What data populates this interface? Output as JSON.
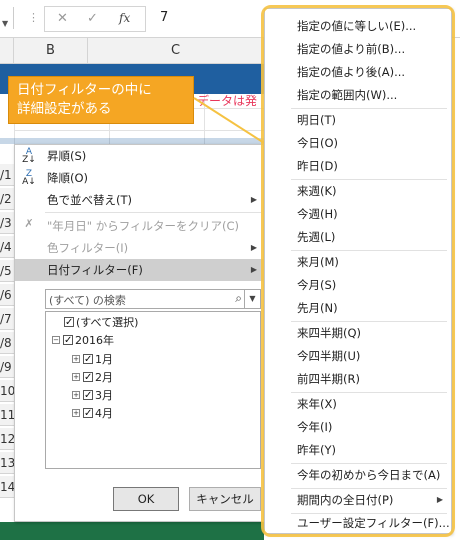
{
  "formula_bar": {
    "value": "7"
  },
  "columns": [
    {
      "label": "B"
    },
    {
      "label": "C"
    }
  ],
  "row_numbers": [
    "/1",
    "/2",
    "/3",
    "/4",
    "/5",
    "/6",
    "/7",
    "/8",
    "/9",
    "10",
    "11",
    "12",
    "13",
    "14"
  ],
  "sheet": {
    "pink_text": "データは発"
  },
  "callout": {
    "line1": "日付フィルターの中に",
    "line2": "詳細設定がある"
  },
  "filter_menu": {
    "items": [
      {
        "label": "昇順(S)"
      },
      {
        "label": "降順(O)"
      },
      {
        "label": "色で並べ替え(T)"
      },
      {
        "label": "\"年月日\" からフィルターをクリア(C)"
      },
      {
        "label": "色フィルター(I)"
      },
      {
        "label": "日付フィルター(F)"
      }
    ],
    "search_placeholder": "(すべて) の検索",
    "tree": [
      {
        "label": "(すべて選択)"
      },
      {
        "label": "2016年"
      },
      {
        "label": "1月"
      },
      {
        "label": "2月"
      },
      {
        "label": "3月"
      },
      {
        "label": "4月"
      }
    ],
    "ok_label": "OK",
    "cancel_label": "キャンセル"
  },
  "date_filter_submenu": {
    "group1": [
      "指定の値に等しい(E)...",
      "指定の値より前(B)...",
      "指定の値より後(A)...",
      "指定の範囲内(W)..."
    ],
    "group2": [
      "明日(T)",
      "今日(O)",
      "昨日(D)"
    ],
    "group3": [
      "来週(K)",
      "今週(H)",
      "先週(L)"
    ],
    "group4": [
      "来月(M)",
      "今月(S)",
      "先月(N)"
    ],
    "group5": [
      "来四半期(Q)",
      "今四半期(U)",
      "前四半期(R)"
    ],
    "group6": [
      "来年(X)",
      "今年(I)",
      "昨年(Y)"
    ],
    "group7": [
      "今年の初めから今日まで(A)"
    ],
    "group8": [
      "期間内の全日付(P)"
    ],
    "group9": [
      "ユーザー設定フィルター(F)..."
    ]
  },
  "colors": {
    "highlight": "#f5c242",
    "callout": "#f5a623",
    "header_blue": "#1f5fa0"
  }
}
